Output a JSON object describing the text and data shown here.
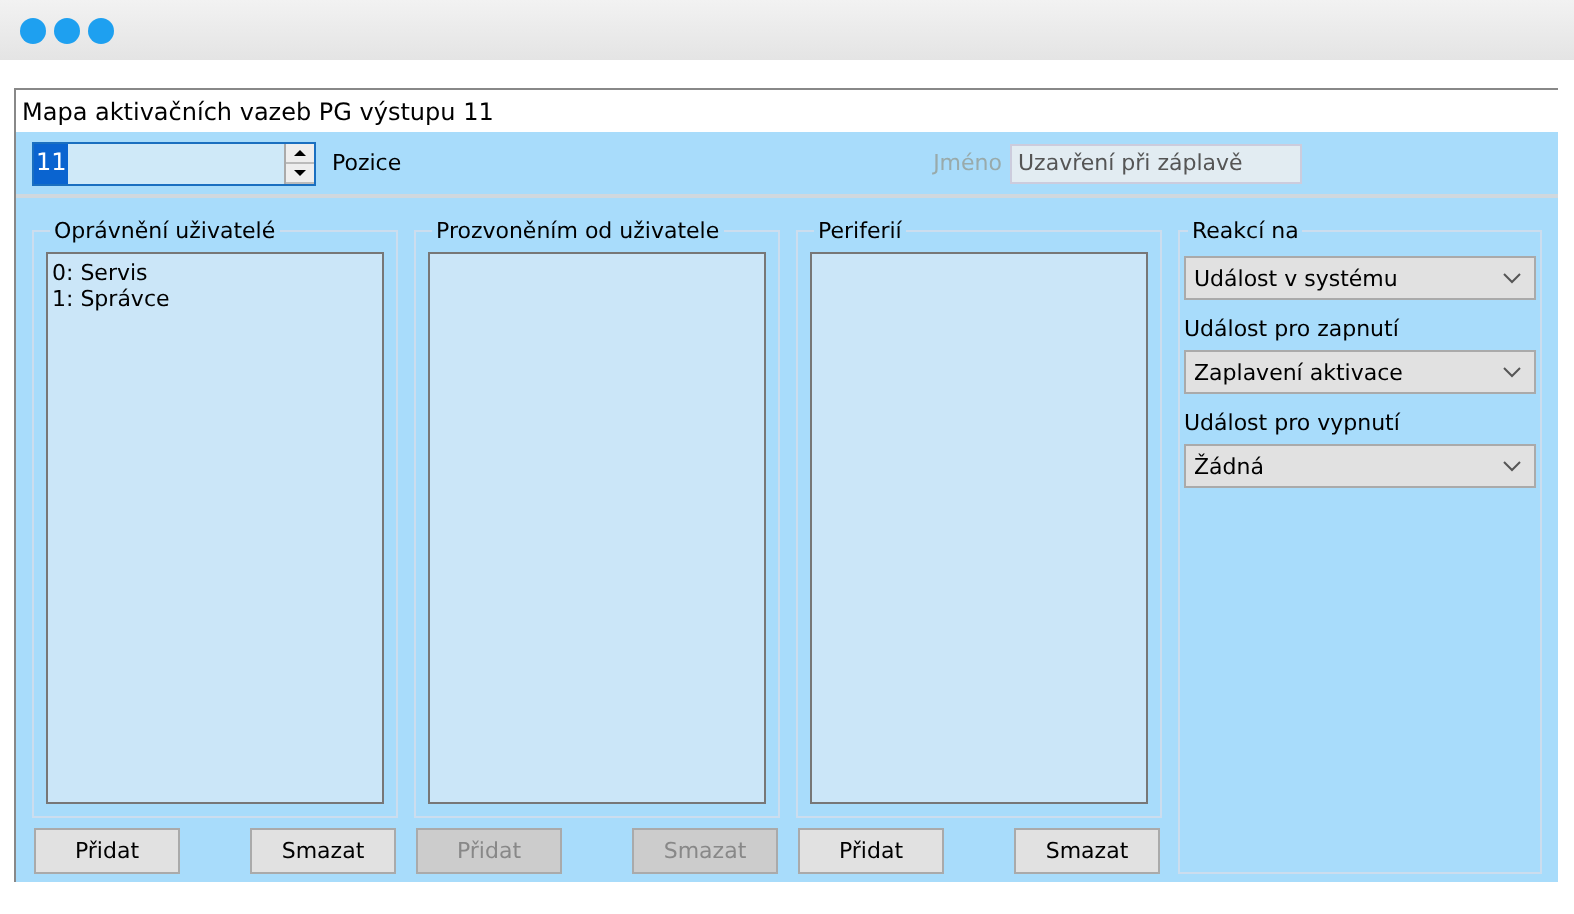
{
  "window": {
    "title": "Mapa aktivačních vazeb PG výstupu 11"
  },
  "position": {
    "value": "11",
    "label": "Pozice"
  },
  "name": {
    "label": "Jméno",
    "value": "Uzavření při záplavě",
    "disabled": true
  },
  "groups": [
    {
      "title": "Oprávnění uživatelé",
      "items": [
        "0: Servis",
        "1: Správce"
      ],
      "buttons": [
        {
          "label": "Přidat",
          "disabled": false
        },
        {
          "label": "Smazat",
          "disabled": false
        }
      ]
    },
    {
      "title": "Prozvoněním od uživatele",
      "buttons": [
        {
          "label": "Přidat",
          "disabled": true
        },
        {
          "label": "Smazat",
          "disabled": true
        }
      ]
    },
    {
      "title": "Periferií",
      "buttons": [
        {
          "label": "Přidat",
          "disabled": false
        },
        {
          "label": "Smazat",
          "disabled": false
        }
      ]
    }
  ],
  "reaction": {
    "title": "Reakcí na",
    "fields": [
      {
        "value": "Událost v systému"
      },
      {
        "label": "Událost pro zapnutí",
        "value": "Zaplavení aktivace"
      },
      {
        "label": "Událost pro vypnutí",
        "value": "Žádná"
      }
    ]
  }
}
